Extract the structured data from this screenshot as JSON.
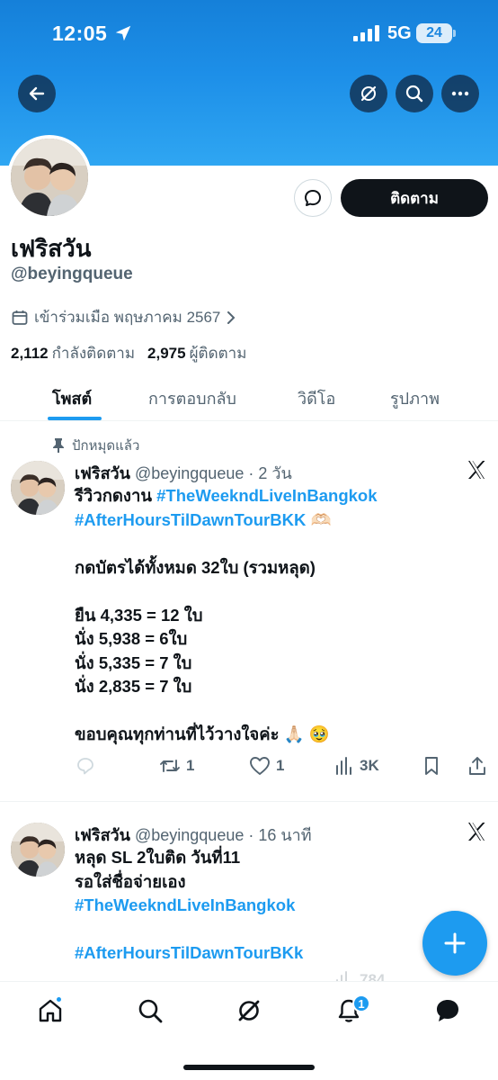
{
  "status_bar": {
    "time": "12:05",
    "network": "5G",
    "battery": "24"
  },
  "profile": {
    "display_name": "เฟริสวัน",
    "handle": "@beyingqueue",
    "joined": "เข้าร่วมเมือ พฤษภาคม 2567",
    "following_count": "2,112",
    "following_label": "กำลังติดตาม",
    "followers_count": "2,975",
    "followers_label": "ผู้ติดตาม",
    "follow_label": "ติดตาม"
  },
  "tabs": [
    {
      "label": "โพสต์",
      "active": true
    },
    {
      "label": "การตอบกลับ",
      "active": false
    },
    {
      "label": "วิดีโอ",
      "active": false
    },
    {
      "label": "รูปภาพ",
      "active": false
    }
  ],
  "pinned_label": "ปักหมุดแล้ว",
  "tweets": [
    {
      "name": "เฟริสวัน",
      "handle_time": "@beyingqueue · 2 วัน",
      "line1_text": "รีวิวกดงาน ",
      "line1_tag": "#TheWeekndLiveInBangkok",
      "line2_tag": "#AfterHoursTilDawnTourBKK",
      "line2_emoji": "🫶🏻",
      "line3": "กดบัตรได้ทั้งหมด 32ใบ (รวมหลุด)",
      "line4": "ยืน 4,335 = 12 ใบ",
      "line5": "นั่ง 5,938 = 6ใบ",
      "line6": "นั่ง 5,335 = 7 ใบ",
      "line7": "นั่ง 2,835 = 7 ใบ",
      "line8_text": "ขอบคุณทุกท่านที่ไว้วางใจค่ะ ",
      "line8_emoji": "🙏🏻 🥹",
      "retweets": "1",
      "likes": "1",
      "views": "3K"
    },
    {
      "name": "เฟริสวัน",
      "handle_time": "@beyingqueue · 16 นาที",
      "line1": "หลุด SL 2ใบติด วันที่11",
      "line2": "รอใส่ชื่อจ่ายเอง",
      "line3_tag": " #TheWeekndLiveInBangkok",
      "line4_tag": "#AfterHoursTilDawnTourBKk",
      "views": "784"
    }
  ],
  "nav": {
    "notification_count": "1"
  },
  "colors": {
    "accent": "#1d9bf0",
    "banner": "#1d8fe8",
    "text": "#0f1419",
    "muted": "#536471"
  }
}
